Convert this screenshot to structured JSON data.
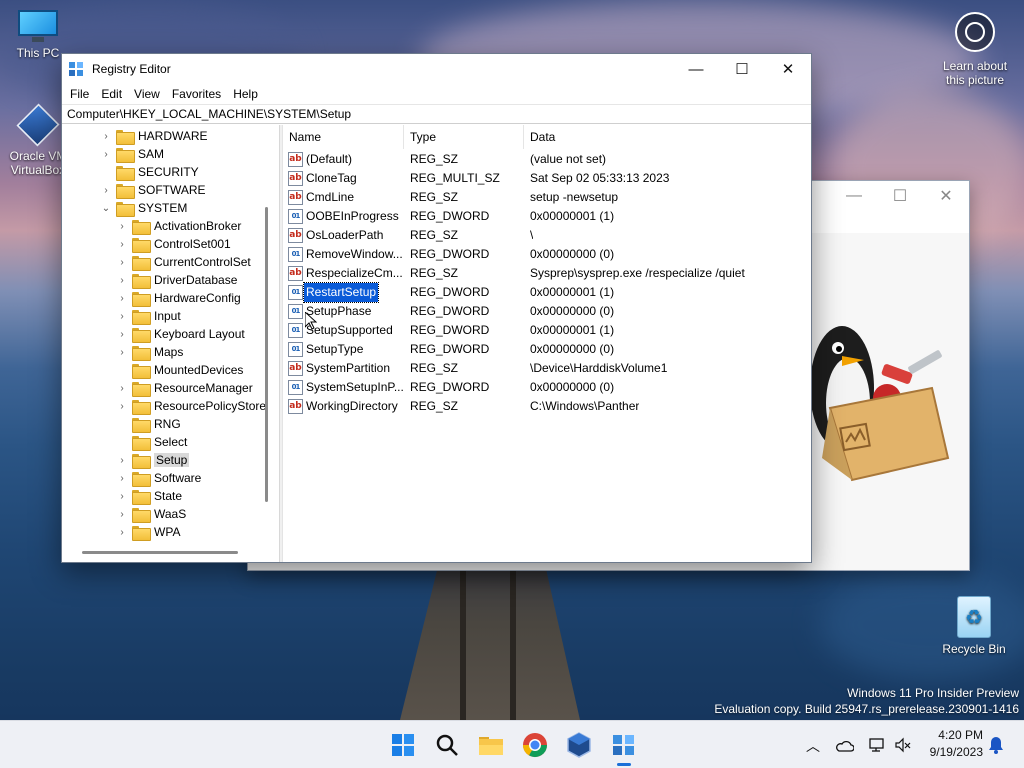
{
  "desktop": {
    "icons": [
      {
        "label": "This PC"
      },
      {
        "label": "Oracle VM VirtualBox"
      },
      {
        "label": "Recycle Bin"
      }
    ],
    "learn_label": "Learn about this picture",
    "watermark_line1": "Windows 11 Pro Insider Preview",
    "watermark_line2": "Evaluation copy. Build 25947.rs_prerelease.230901-1416"
  },
  "regedit": {
    "title": "Registry Editor",
    "minimize": "—",
    "maximize": "☐",
    "close": "✕",
    "menus": [
      "File",
      "Edit",
      "View",
      "Favorites",
      "Help"
    ],
    "address": "Computer\\HKEY_LOCAL_MACHINE\\SYSTEM\\Setup",
    "tree": [
      {
        "label": "HARDWARE",
        "chev": "›"
      },
      {
        "label": "SAM",
        "chev": "›"
      },
      {
        "label": "SECURITY",
        "chev": ""
      },
      {
        "label": "SOFTWARE",
        "chev": "›"
      },
      {
        "label": "SYSTEM",
        "chev": "⌄"
      },
      {
        "label": "ActivationBroker",
        "chev": "›"
      },
      {
        "label": "ControlSet001",
        "chev": "›"
      },
      {
        "label": "CurrentControlSet",
        "chev": "›"
      },
      {
        "label": "DriverDatabase",
        "chev": "›"
      },
      {
        "label": "HardwareConfig",
        "chev": "›"
      },
      {
        "label": "Input",
        "chev": "›"
      },
      {
        "label": "Keyboard Layout",
        "chev": "›"
      },
      {
        "label": "Maps",
        "chev": "›"
      },
      {
        "label": "MountedDevices",
        "chev": ""
      },
      {
        "label": "ResourceManager",
        "chev": "›"
      },
      {
        "label": "ResourcePolicyStore",
        "chev": "›"
      },
      {
        "label": "RNG",
        "chev": ""
      },
      {
        "label": "Select",
        "chev": ""
      },
      {
        "label": "Setup",
        "chev": "›"
      },
      {
        "label": "Software",
        "chev": "›"
      },
      {
        "label": "State",
        "chev": "›"
      },
      {
        "label": "WaaS",
        "chev": "›"
      },
      {
        "label": "WPA",
        "chev": "›"
      }
    ],
    "columns": {
      "name": "Name",
      "type": "Type",
      "data": "Data"
    },
    "values": [
      {
        "name": "(Default)",
        "type": "REG_SZ",
        "data": "(value not set)",
        "icon": "ab"
      },
      {
        "name": "CloneTag",
        "type": "REG_MULTI_SZ",
        "data": "Sat Sep 02 05:33:13 2023",
        "icon": "ab"
      },
      {
        "name": "CmdLine",
        "type": "REG_SZ",
        "data": "setup -newsetup",
        "icon": "ab"
      },
      {
        "name": "OOBEInProgress",
        "type": "REG_DWORD",
        "data": "0x00000001 (1)",
        "icon": "01"
      },
      {
        "name": "OsLoaderPath",
        "type": "REG_SZ",
        "data": "\\",
        "icon": "ab"
      },
      {
        "name": "RemoveWindow...",
        "type": "REG_DWORD",
        "data": "0x00000000 (0)",
        "icon": "01"
      },
      {
        "name": "RespecializeCm...",
        "type": "REG_SZ",
        "data": "Sysprep\\sysprep.exe /respecialize /quiet",
        "icon": "ab"
      },
      {
        "name": "RestartSetup",
        "type": "REG_DWORD",
        "data": "0x00000001 (1)",
        "icon": "01"
      },
      {
        "name": "SetupPhase",
        "type": "REG_DWORD",
        "data": "0x00000000 (0)",
        "icon": "01"
      },
      {
        "name": "SetupSupported",
        "type": "REG_DWORD",
        "data": "0x00000001 (1)",
        "icon": "01"
      },
      {
        "name": "SetupType",
        "type": "REG_DWORD",
        "data": "0x00000000 (0)",
        "icon": "01"
      },
      {
        "name": "SystemPartition",
        "type": "REG_SZ",
        "data": "\\Device\\HarddiskVolume1",
        "icon": "ab"
      },
      {
        "name": "SystemSetupInP...",
        "type": "REG_DWORD",
        "data": "0x00000000 (0)",
        "icon": "01"
      },
      {
        "name": "WorkingDirectory",
        "type": "REG_SZ",
        "data": "C:\\Windows\\Panther",
        "icon": "ab"
      }
    ]
  },
  "bg_window": {
    "minimize": "—",
    "maximize": "☐",
    "close": "✕"
  },
  "taskbar": {
    "time": "4:20 PM",
    "date": "9/19/2023",
    "icons": [
      "windows-start-icon",
      "search-icon",
      "file-explorer-icon",
      "chrome-icon",
      "virtualbox-icon",
      "registry-editor-icon"
    ]
  }
}
